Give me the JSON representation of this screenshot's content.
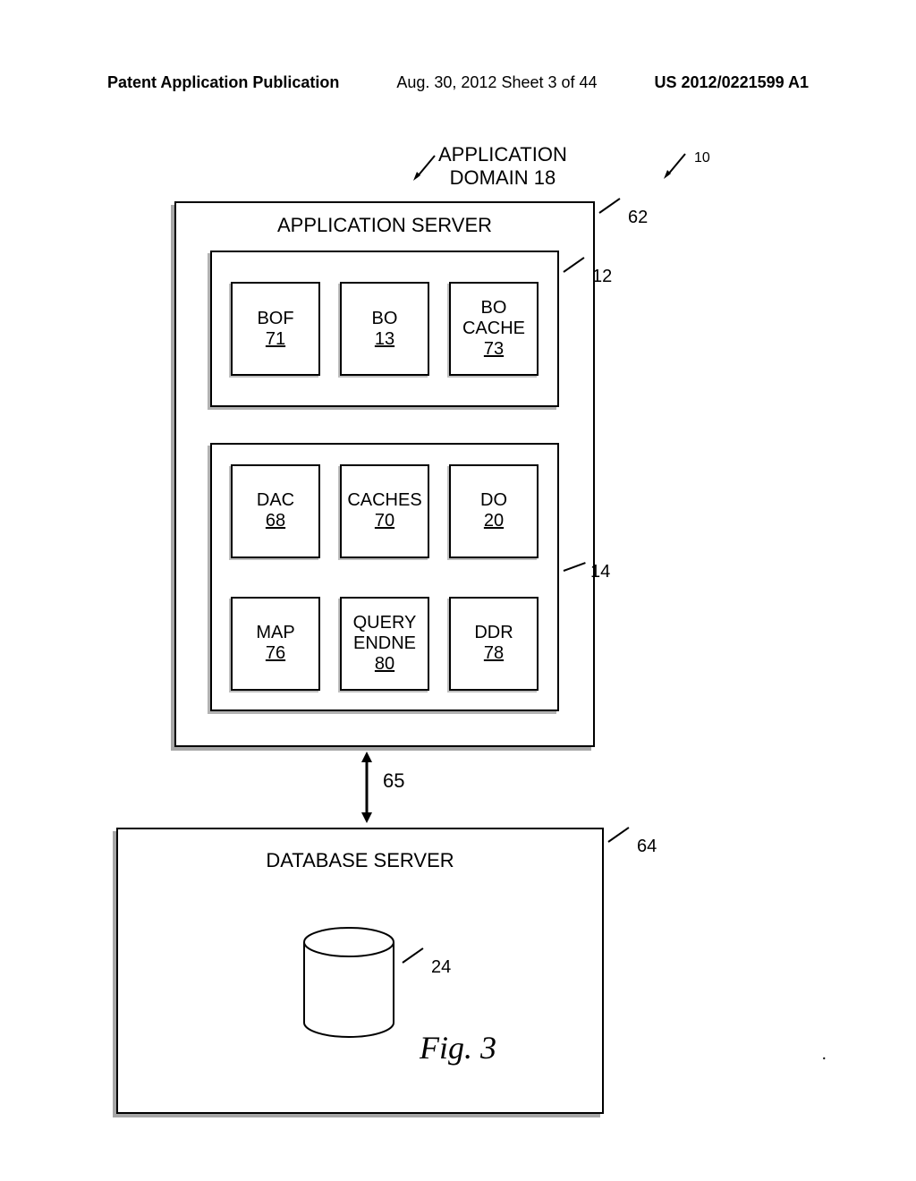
{
  "header": {
    "left": "Patent Application Publication",
    "center": "Aug. 30, 2012  Sheet 3 of 44",
    "right": "US 2012/0221599 A1"
  },
  "labels": {
    "app_domain_line1": "APPLICATION",
    "app_domain_line2": "DOMAIN 18",
    "ref_10": "10",
    "ref_62": "62",
    "ref_12": "12",
    "ref_14": "14",
    "ref_65": "65",
    "ref_64": "64",
    "ref_24": "24"
  },
  "app_server": {
    "title": "APPLICATION SERVER"
  },
  "container12": {
    "boxes": [
      {
        "label": "BOF",
        "num": "71"
      },
      {
        "label": "BO",
        "num": "13"
      },
      {
        "label1": "BO",
        "label2": "CACHE",
        "num": "73"
      }
    ]
  },
  "container14": {
    "row1": [
      {
        "label": "DAC",
        "num": "68"
      },
      {
        "label": "CACHES",
        "num": "70"
      },
      {
        "label": "DO",
        "num": "20"
      }
    ],
    "row2": [
      {
        "label": "MAP",
        "num": "76"
      },
      {
        "label1": "QUERY",
        "label2": "ENDNE",
        "num": "80"
      },
      {
        "label": "DDR",
        "num": "78"
      }
    ]
  },
  "db_server": {
    "title": "DATABASE SERVER"
  },
  "figure_caption": "Fig. 3"
}
